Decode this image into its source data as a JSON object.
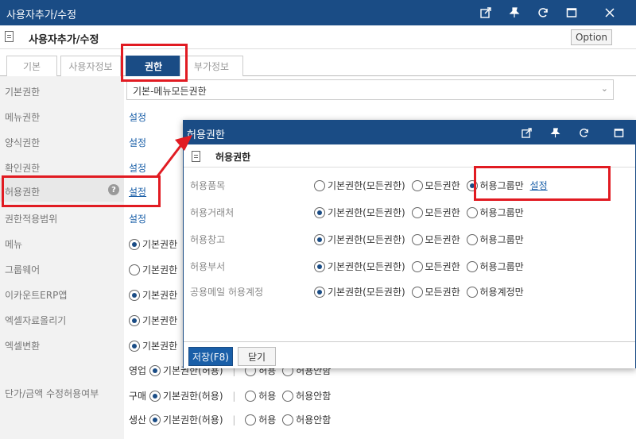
{
  "window": {
    "title": "사용자추가/수정",
    "subtitle": "사용자추가/수정",
    "option_label": "Option"
  },
  "tabs": [
    {
      "label": "기본",
      "active": false
    },
    {
      "label": "사용자정보",
      "active": false
    },
    {
      "label": "권한",
      "active": true
    },
    {
      "label": "부가정보",
      "active": false
    }
  ],
  "form": {
    "basic_right": {
      "label": "기본권한",
      "value": "기본-메뉴모든권한"
    },
    "menu_right": {
      "label": "메뉴권한",
      "link": "설정"
    },
    "form_right": {
      "label": "양식권한",
      "link": "설정"
    },
    "confirm_right": {
      "label": "확인권한",
      "link": "설정"
    },
    "allow_right": {
      "label": "허용권한",
      "link": "설정"
    },
    "apply_scope": {
      "label": "권한적용범위",
      "link": "설정"
    },
    "menu": {
      "label": "메뉴",
      "option": "기본권한"
    },
    "groupware": {
      "label": "그룹웨어",
      "option": "기본권한"
    },
    "ecount_erp_app": {
      "label": "이카운트ERP앱",
      "option": "기본권한"
    },
    "excel_upload": {
      "label": "엑셀자료올리기",
      "option": "기본권한"
    },
    "excel_convert": {
      "label": "엑셀변환",
      "option": "기본권한"
    },
    "price_edit": {
      "label": "단가/금액 수정허용여부",
      "rows": [
        {
          "name": "영업",
          "opt1": "기본권한(허용)",
          "opt2": "허용",
          "opt3": "허용안함"
        },
        {
          "name": "구매",
          "opt1": "기본권한(허용)",
          "opt2": "허용",
          "opt3": "허용안함"
        },
        {
          "name": "생산",
          "opt1": "기본권한(허용)",
          "opt2": "허용",
          "opt3": "허용안함"
        }
      ],
      "separator": "|"
    }
  },
  "dialog": {
    "title": "허용권한",
    "subtitle": "허용권한",
    "rows": [
      {
        "label": "허용품목",
        "opt1": "기본권한(모든권한)",
        "opt2": "모든권한",
        "opt3": "허용그룹만",
        "selected": 3,
        "link": "설정"
      },
      {
        "label": "허용거래처",
        "opt1": "기본권한(모든권한)",
        "opt2": "모든권한",
        "opt3": "허용그룹만",
        "selected": 1,
        "link": ""
      },
      {
        "label": "허용창고",
        "opt1": "기본권한(모든권한)",
        "opt2": "모든권한",
        "opt3": "허용그룹만",
        "selected": 1,
        "link": ""
      },
      {
        "label": "허용부서",
        "opt1": "기본권한(모든권한)",
        "opt2": "모든권한",
        "opt3": "허용그룹만",
        "selected": 1,
        "link": ""
      },
      {
        "label": "공용메일 허용계정",
        "opt1": "기본권한(모든권한)",
        "opt2": "모든권한",
        "opt3": "허용계정만",
        "selected": 1,
        "link": ""
      }
    ],
    "save_label": "저장(F8)",
    "close_label": "닫기"
  },
  "colors": {
    "primary": "#1a4c85",
    "link": "#1a5fa8",
    "annotation": "#e11b22",
    "label_bg": "#f2f2f2"
  }
}
